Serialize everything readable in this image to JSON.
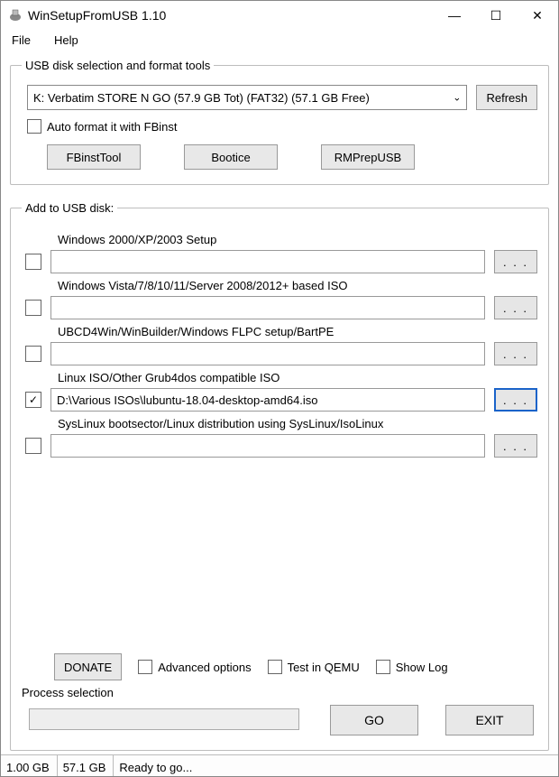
{
  "window": {
    "title": "WinSetupFromUSB 1.10"
  },
  "menu": {
    "file": "File",
    "help": "Help"
  },
  "usb_group": {
    "legend": "USB disk selection and format tools",
    "drive_selected": "K: Verbatim STORE N GO (57.9 GB Tot) (FAT32) (57.1 GB Free)",
    "refresh": "Refresh",
    "autoformat_label": "Auto format it with FBinst",
    "tools": {
      "fbinst": "FBinstTool",
      "bootice": "Bootice",
      "rmprep": "RMPrepUSB"
    }
  },
  "add_group": {
    "legend": "Add to USB disk:",
    "items": [
      {
        "label": "Windows 2000/XP/2003 Setup",
        "checked": false,
        "value": ""
      },
      {
        "label": "Windows Vista/7/8/10/11/Server 2008/2012+ based ISO",
        "checked": false,
        "value": ""
      },
      {
        "label": "UBCD4Win/WinBuilder/Windows FLPC setup/BartPE",
        "checked": false,
        "value": ""
      },
      {
        "label": "Linux ISO/Other Grub4dos compatible ISO",
        "checked": true,
        "value": "D:\\Various ISOs\\lubuntu-18.04-desktop-amd64.iso"
      },
      {
        "label": "SysLinux bootsector/Linux distribution using SysLinux/IsoLinux",
        "checked": false,
        "value": ""
      }
    ],
    "donate": "DONATE",
    "adv_options": "Advanced options",
    "test_qemu": "Test in QEMU",
    "show_log": "Show Log",
    "process_selection": "Process selection",
    "go": "GO",
    "exit": "EXIT"
  },
  "status": {
    "cell1": "1.00 GB",
    "cell2": "57.1 GB",
    "cell3": "Ready to go..."
  },
  "glyphs": {
    "check": "✓",
    "dots": ". . .",
    "min": "—",
    "max": "☐",
    "close": "✕",
    "chev": "⌄"
  }
}
